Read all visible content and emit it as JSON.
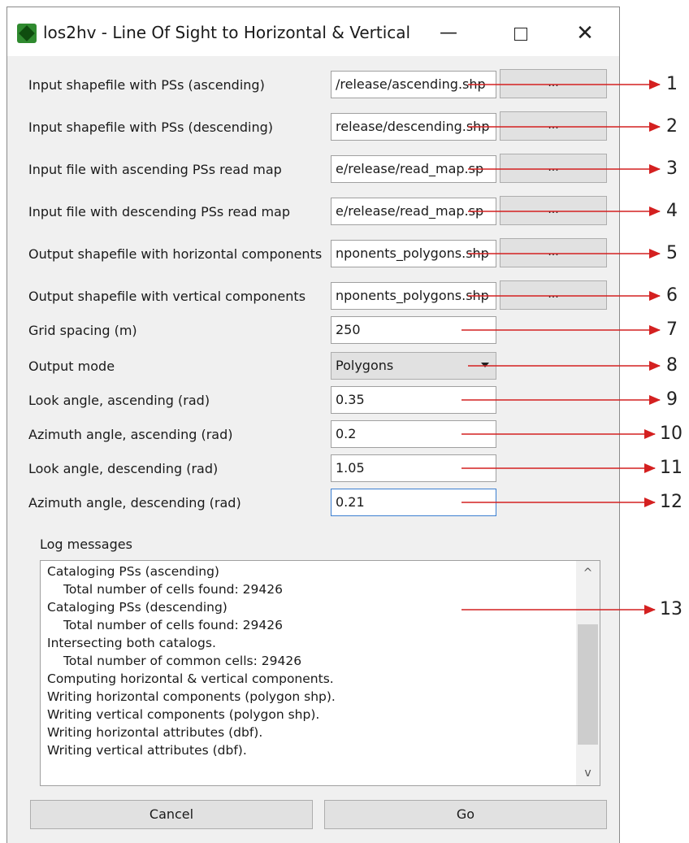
{
  "window": {
    "title": "los2hv - Line Of Sight to Horizontal & Vertical",
    "minimize_glyph": "—",
    "close_glyph": "✕"
  },
  "form": {
    "rows": [
      {
        "label": "Input shapefile with PSs (ascending)",
        "value": "/release/ascending.shp",
        "browse_label": "..."
      },
      {
        "label": "Input shapefile with PSs (descending)",
        "value": "release/descending.shp",
        "browse_label": "..."
      },
      {
        "label": "Input file with ascending PSs read map",
        "value": "e/release/read_map.sp",
        "browse_label": "..."
      },
      {
        "label": "Input file with descending PSs read map",
        "value": "e/release/read_map.sp",
        "browse_label": "..."
      },
      {
        "label": "Output shapefile with horizontal components",
        "value": "nponents_polygons.shp",
        "browse_label": "..."
      },
      {
        "label": "Output shapefile with vertical components",
        "value": "nponents_polygons.shp",
        "browse_label": "..."
      }
    ],
    "grid_spacing": {
      "label": "Grid spacing (m)",
      "value": "250"
    },
    "output_mode": {
      "label": "Output mode",
      "value": "Polygons"
    },
    "look_angle_asc": {
      "label": "Look angle, ascending (rad)",
      "value": "0.35"
    },
    "azimuth_angle_asc": {
      "label": "Azimuth angle, ascending (rad)",
      "value": "0.2"
    },
    "look_angle_desc": {
      "label": "Look angle, descending (rad)",
      "value": "1.05"
    },
    "azimuth_angle_desc": {
      "label": "Azimuth angle, descending (rad)",
      "value": "0.21"
    }
  },
  "log": {
    "label": "Log messages",
    "lines": [
      {
        "text": "Cataloging PSs (ascending)",
        "indent": false
      },
      {
        "text": "Total number of cells found: 29426",
        "indent": true
      },
      {
        "text": "Cataloging PSs (descending)",
        "indent": false
      },
      {
        "text": "Total number of cells found: 29426",
        "indent": true
      },
      {
        "text": "Intersecting both catalogs.",
        "indent": false
      },
      {
        "text": "Total number of common cells: 29426",
        "indent": true
      },
      {
        "text": "Computing horizontal & vertical components.",
        "indent": false
      },
      {
        "text": "Writing horizontal components (polygon shp).",
        "indent": false
      },
      {
        "text": "Writing vertical components (polygon shp).",
        "indent": false
      },
      {
        "text": "Writing horizontal attributes (dbf).",
        "indent": false
      },
      {
        "text": "Writing vertical attributes (dbf).",
        "indent": false
      }
    ],
    "scroll_up_glyph": "^",
    "scroll_down_glyph": "v"
  },
  "buttons": {
    "cancel": "Cancel",
    "go": "Go"
  },
  "callouts": [
    "1",
    "2",
    "3",
    "4",
    "5",
    "6",
    "7",
    "8",
    "9",
    "10",
    "11",
    "12",
    "13"
  ],
  "colors": {
    "arrow": "#d42020"
  }
}
